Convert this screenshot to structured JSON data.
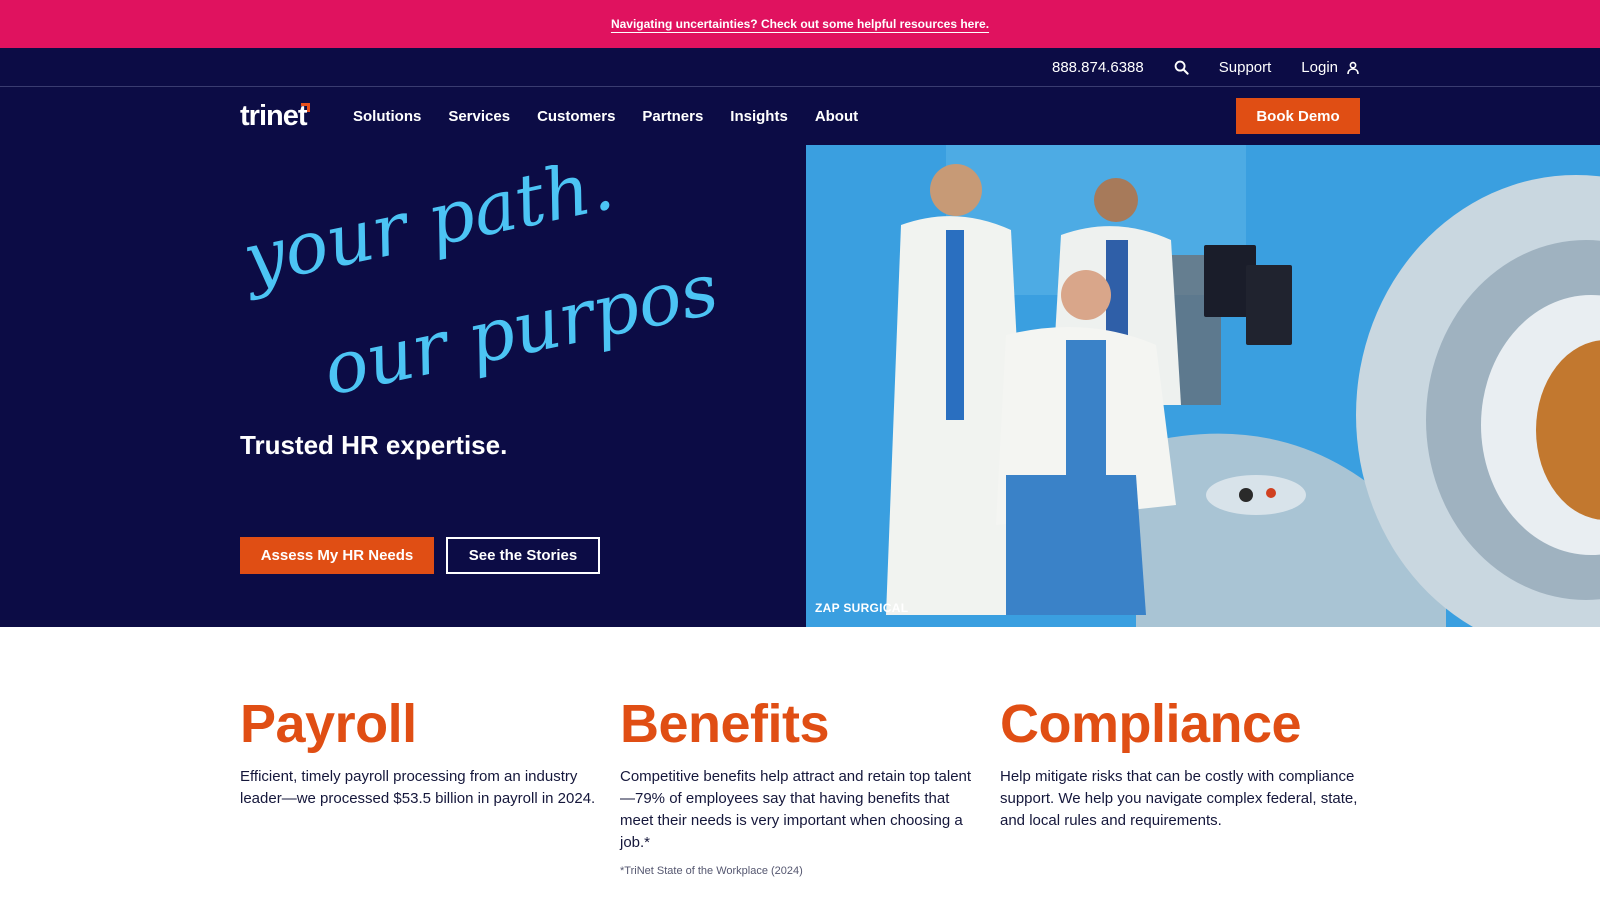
{
  "alert": {
    "link_text": "Navigating uncertainties? Check out some helpful resources here."
  },
  "utility": {
    "phone": "888.874.6388",
    "search_icon": "search-icon",
    "support": "Support",
    "login": "Login",
    "user_icon": "user-icon"
  },
  "nav": {
    "logo": "trinet",
    "items": [
      "Solutions",
      "Services",
      "Customers",
      "Partners",
      "Insights",
      "About"
    ],
    "cta": "Book Demo"
  },
  "hero": {
    "script_line1": "your path.",
    "script_line2": "our purpose.",
    "subtitle": "Trusted HR expertise.",
    "primary_button": "Assess My HR Needs",
    "secondary_button": "See the Stories",
    "photo_caption": "ZAP SURGICAL"
  },
  "features": [
    {
      "title": "Payroll",
      "text": "Efficient, timely payroll processing from an industry leader—we processed $53.5 billion in payroll in 2024."
    },
    {
      "title": "Benefits",
      "text": "Competitive benefits help attract and retain top talent—79% of employees say that having benefits that meet their needs is very important when choosing a job.*"
    },
    {
      "title": "Compliance",
      "text": "Help mitigate risks that can be costly with compliance support. We help you navigate complex federal, state, and local rules and requirements."
    }
  ],
  "footnote": "*TriNet State of the Workplace (2024)",
  "colors": {
    "alert": "#e0125f",
    "navy": "#0c0c45",
    "accent_orange": "#e04e14",
    "script_blue": "#4cc4f4"
  }
}
